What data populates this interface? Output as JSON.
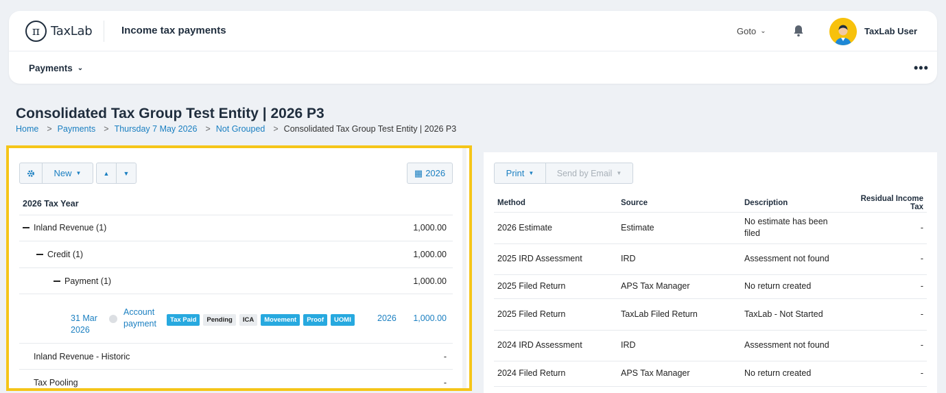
{
  "header": {
    "logo_text": "TaxLab",
    "app_title": "Income tax payments",
    "goto_label": "Goto",
    "user_name": "TaxLab User",
    "nav_menu_label": "Payments",
    "more_label": "•••"
  },
  "page": {
    "title": "Consolidated Tax Group Test Entity | 2026 P3",
    "breadcrumb": [
      "Home",
      "Payments",
      "Thursday 7 May 2026",
      "Not Grouped",
      "Consolidated Tax Group Test Entity | 2026 P3"
    ]
  },
  "left": {
    "new_label": "New",
    "year_button": "2026",
    "tree_header": "2026 Tax Year",
    "rows": [
      {
        "label": "Inland Revenue (1)",
        "amount": "1,000.00"
      },
      {
        "label": "Credit (1)",
        "amount": "1,000.00"
      },
      {
        "label": "Payment (1)",
        "amount": "1,000.00"
      }
    ],
    "payment": {
      "date": "31 Mar 2026",
      "type": "Account payment",
      "tags": [
        "Tax Paid",
        "Pending",
        "ICA",
        "Movement",
        "Proof",
        "UOMI"
      ],
      "year": "2026",
      "amount": "1,000.00"
    },
    "historic": {
      "label": "Inland Revenue - Historic",
      "amount": "-"
    },
    "pooling": {
      "label": "Tax Pooling",
      "amount": "-"
    }
  },
  "right": {
    "print_label": "Print",
    "email_label": "Send by Email",
    "columns": [
      "Method",
      "Source",
      "Description",
      "Residual Income Tax"
    ],
    "rows": [
      {
        "method": "2026 Estimate",
        "source": "Estimate",
        "description": "No estimate has been filed",
        "rit": "-"
      },
      {
        "method": "2025 IRD Assessment",
        "source": "IRD",
        "description": "Assessment not found",
        "rit": "-"
      },
      {
        "method": "2025 Filed Return",
        "source": "APS Tax Manager",
        "description": "No return created",
        "rit": "-"
      },
      {
        "method": "2025 Filed Return",
        "source": "TaxLab Filed Return",
        "description": "TaxLab - Not Started",
        "rit": "-"
      },
      {
        "method": "2024 IRD Assessment",
        "source": "IRD",
        "description": "Assessment not found",
        "rit": "-"
      },
      {
        "method": "2024 Filed Return",
        "source": "APS Tax Manager",
        "description": "No return created",
        "rit": "-"
      }
    ]
  },
  "colors": {
    "accent": "#1a7fc1",
    "highlight": "#f5c518",
    "tag_blue": "#27a9df"
  }
}
